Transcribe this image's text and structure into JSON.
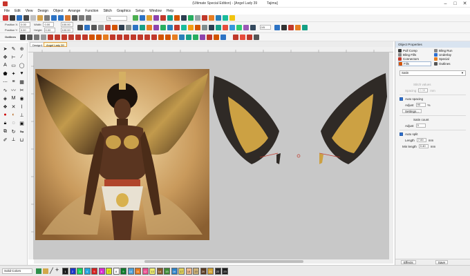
{
  "titlebar": {
    "title": "(Ultimate Special Edition) - [Angel Lady 39",
    "title_suffix": "Tajima]",
    "minimize": "–",
    "maximize": "□",
    "close": "✕",
    "icon_color": "#c8342c"
  },
  "menu": [
    "File",
    "Edit",
    "View",
    "Design",
    "Object",
    "Arrange",
    "Function",
    "Stitch",
    "Graphics",
    "Setup",
    "Window",
    "Help"
  ],
  "toolbar": {
    "position_x_label": "Position X:",
    "position_y_label": "Position Y:",
    "position_x_value": "0.00",
    "position_y_value": "0.00",
    "width_label": "Width:",
    "height_label": "Height:",
    "width_value": "0.00",
    "height_value": "0.00",
    "zoom_value": "75",
    "outlines_label": "Outlines",
    "size_value": "0/5",
    "scale_a": "100.00",
    "scale_b": "100.00"
  },
  "tabs": {
    "design": "Design1",
    "angel": "Angel Lady 39"
  },
  "properties": {
    "title": "Object Properties",
    "tabs": [
      "Pull Comp",
      "Bling Run",
      "Bling Fills",
      "Underlay",
      "Connectors",
      "Special",
      "Fills",
      "Outlines"
    ],
    "active_tab": "Fills",
    "fill_type": "Satin",
    "stitch_values_label": "Stitch values",
    "spacing_label": "Spacing",
    "spacing_value": "0.38",
    "spacing_unit": "mm",
    "auto_spacing_label": "Auto spacing",
    "adjust_label": "Adjust",
    "adjust_value": "90",
    "adjust_unit": "%",
    "settings_label": "Settings...",
    "satin_count_label": "Satin count",
    "satin_adjust_label": "Adjust",
    "satin_adjust_value": "3",
    "auto_split_label": "Auto split",
    "length_label": "Length",
    "length_value": "7.00",
    "length_unit": "mm",
    "min_length_label": "Min length",
    "min_length_value": "0.40",
    "min_length_unit": "mm",
    "effects_label": "Effects",
    "save_label": "Save",
    "accent": "#2c6fd1"
  },
  "status": {
    "color_field": "Solid Colors"
  },
  "palette": [
    {
      "color": "#1a1a1a",
      "label": "1"
    },
    {
      "color": "#1a35c8",
      "label": "2"
    },
    {
      "color": "#16d45a",
      "label": "3"
    },
    {
      "color": "#23a5e0",
      "label": "4"
    },
    {
      "color": "#d61f1f",
      "label": "5"
    },
    {
      "color": "#d92bd0",
      "label": "6"
    },
    {
      "color": "#d7e41a",
      "label": "7"
    },
    {
      "color": "#ffffff",
      "label": "8"
    },
    {
      "color": "#0f7b2a",
      "label": "9"
    },
    {
      "color": "#4ba0d8",
      "label": "10"
    },
    {
      "color": "#e47a1d",
      "label": "11"
    },
    {
      "color": "#eb4e8e",
      "label": "12"
    },
    {
      "color": "#f0ef71",
      "label": "13"
    },
    {
      "color": "#8b5a2b",
      "label": "14"
    },
    {
      "color": "#3b8b34",
      "label": "15"
    },
    {
      "color": "#2c82c9",
      "label": "16"
    },
    {
      "color": "#e0d15a",
      "label": "17"
    },
    {
      "color": "#f3b98a",
      "label": "18"
    },
    {
      "color": "#cdb176",
      "label": "19"
    },
    {
      "color": "#5a3a20",
      "label": "20"
    },
    {
      "color": "#d1a230",
      "label": "21"
    },
    {
      "color": "#2a2a2a",
      "label": "22"
    },
    {
      "color": "#1d1d1d",
      "label": "23"
    }
  ]
}
